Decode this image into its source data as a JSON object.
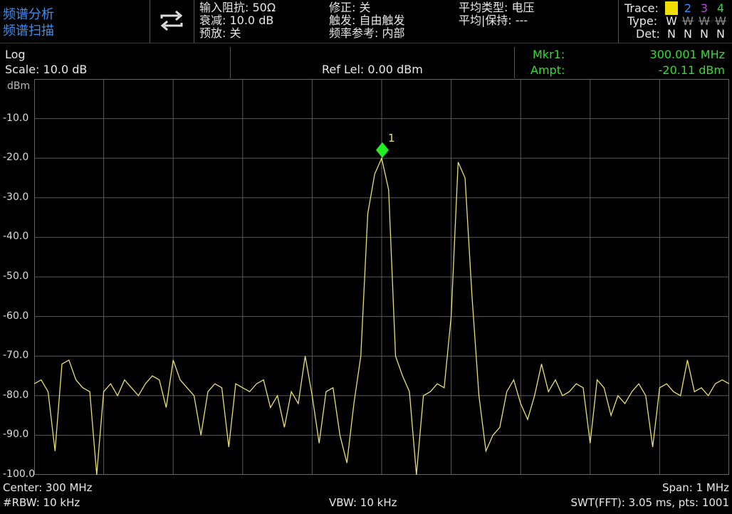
{
  "mode": {
    "line1": "频谱分析",
    "line2": "频谱扫描"
  },
  "settings": {
    "col1": [
      "输入阻抗: 50Ω",
      "衰减: 10.0 dB",
      "预放: 关"
    ],
    "col2": [
      "修正: 关",
      "触发: 自由触发",
      "频率参考: 内部"
    ],
    "col3": [
      "平均类型: 电压",
      "平均|保持: ---"
    ]
  },
  "trace_panel": {
    "trace_label": "Trace:",
    "type_label": "Type:",
    "det_label": "Det:",
    "trace_nums": [
      "1",
      "2",
      "3",
      "4"
    ],
    "types": [
      "W",
      "W",
      "W",
      "W"
    ],
    "dets": [
      "N",
      "N",
      "N",
      "N"
    ],
    "colors": [
      "#f0e000",
      "#3d8ef0",
      "#c040e0",
      "#2fe02f"
    ]
  },
  "scale": {
    "mode": "Log",
    "scale": "Scale: 10.0 dB",
    "unit": "dBm"
  },
  "ref_level": "Ref Lel: 0.00 dBm",
  "marker": {
    "mkr_label": "Mkr1:",
    "mkr_value": "300.001 MHz",
    "ampt_label": "Ampt:",
    "ampt_value": "-20.11 dBm",
    "id": "1"
  },
  "y_ticks": [
    "-10.0",
    "-20.0",
    "-30.0",
    "-40.0",
    "-50.0",
    "-60.0",
    "-70.0",
    "-80.0",
    "-90.0",
    "-100.0"
  ],
  "footer": {
    "center": "Center: 300 MHz",
    "span": "Span: 1 MHz",
    "rbw": "#RBW: 10 kHz",
    "vbw": "VBW: 10 kHz",
    "swt": "SWT(FFT): 3.05 ms, pts: 1001"
  },
  "chart_data": {
    "type": "line",
    "xlabel": "",
    "ylabel": "dBm",
    "x_center_mhz": 300,
    "x_span_mhz": 1,
    "ylim": [
      -100,
      0
    ],
    "grid": true,
    "series": [
      {
        "color": "#e8e070",
        "x": [
          299.5,
          299.51,
          299.52,
          299.53,
          299.54,
          299.55,
          299.56,
          299.57,
          299.58,
          299.59,
          299.6,
          299.61,
          299.62,
          299.63,
          299.64,
          299.65,
          299.66,
          299.67,
          299.68,
          299.69,
          299.7,
          299.71,
          299.72,
          299.73,
          299.74,
          299.75,
          299.76,
          299.77,
          299.78,
          299.79,
          299.8,
          299.81,
          299.82,
          299.83,
          299.84,
          299.85,
          299.86,
          299.87,
          299.88,
          299.89,
          299.9,
          299.91,
          299.92,
          299.93,
          299.94,
          299.95,
          299.96,
          299.97,
          299.98,
          299.99,
          300.0,
          300.01,
          300.02,
          300.03,
          300.04,
          300.05,
          300.06,
          300.07,
          300.08,
          300.09,
          300.1,
          300.11,
          300.12,
          300.13,
          300.14,
          300.15,
          300.16,
          300.17,
          300.18,
          300.19,
          300.2,
          300.21,
          300.22,
          300.23,
          300.24,
          300.25,
          300.26,
          300.27,
          300.28,
          300.29,
          300.3,
          300.31,
          300.32,
          300.33,
          300.34,
          300.35,
          300.36,
          300.37,
          300.38,
          300.39,
          300.4,
          300.41,
          300.42,
          300.43,
          300.44,
          300.45,
          300.46,
          300.47,
          300.48,
          300.49,
          300.5
        ],
        "y": [
          -77,
          -76,
          -79,
          -94,
          -72,
          -71,
          -76,
          -78,
          -79,
          -100,
          -79,
          -77,
          -80,
          -76,
          -78,
          -80,
          -77,
          -75,
          -76,
          -83,
          -71,
          -76,
          -78,
          -80,
          -90,
          -79,
          -77,
          -78,
          -93,
          -77,
          -78,
          -79,
          -77,
          -76,
          -83,
          -80,
          -88,
          -79,
          -82,
          -70,
          -80,
          -92,
          -79,
          -78,
          -90,
          -97,
          -82,
          -70,
          -34,
          -24,
          -20,
          -28,
          -70,
          -75,
          -79,
          -100,
          -80,
          -79,
          -77,
          -78,
          -60,
          -21,
          -25,
          -55,
          -80,
          -94,
          -90,
          -88,
          -79,
          -76,
          -82,
          -86,
          -80,
          -72,
          -79,
          -76,
          -80,
          -79,
          -77,
          -78,
          -92,
          -76,
          -78,
          -85,
          -80,
          -82,
          -79,
          -77,
          -80,
          -93,
          -78,
          -77,
          -79,
          -80,
          -71,
          -79,
          -78,
          -80,
          -77,
          -76,
          -77
        ]
      }
    ]
  }
}
